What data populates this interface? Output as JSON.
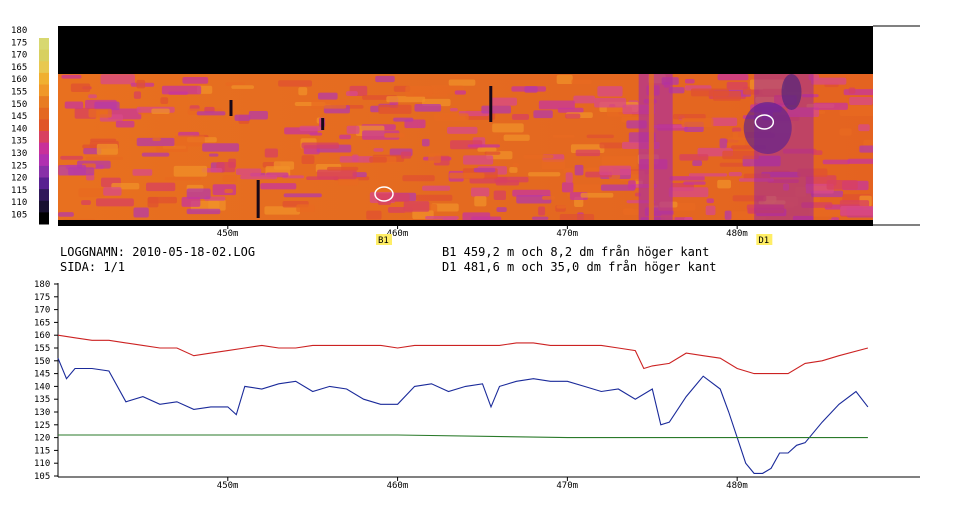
{
  "header": {
    "logname": "LOGGNAMN: 2010-05-18-02.LOG",
    "page": "SIDA: 1/1",
    "markers": [
      "B1 459,2 m och 8,2 dm från höger kant",
      "D1 481,6 m och 35,0 dm från höger kant"
    ]
  },
  "colors": {
    "red_series": "#cc2222",
    "blue_series": "#1a2a9a",
    "green_series": "#2a7a2a",
    "marker_badge": "#ffee66"
  },
  "chart_data": [
    {
      "type": "heatmap",
      "colorscale_ticks": [
        180,
        175,
        170,
        165,
        160,
        155,
        150,
        145,
        140,
        135,
        130,
        125,
        120,
        115,
        110,
        105
      ],
      "x_ticks": [
        "450m",
        "460m",
        "470m",
        "480m"
      ],
      "x_tick_values": [
        450,
        460,
        470,
        480
      ],
      "xlim": [
        440,
        488
      ],
      "markers": [
        {
          "label": "B1",
          "x": 459.2
        },
        {
          "label": "D1",
          "x": 481.6
        }
      ]
    },
    {
      "type": "line",
      "x_ticks": [
        "450m",
        "460m",
        "470m",
        "480m"
      ],
      "x_tick_values": [
        450,
        460,
        470,
        480
      ],
      "xlim": [
        440,
        488
      ],
      "y_ticks": [
        180,
        175,
        170,
        165,
        160,
        155,
        150,
        145,
        140,
        135,
        130,
        125,
        120,
        115,
        110,
        105
      ],
      "ylim": [
        105,
        180
      ],
      "grid": false,
      "series": [
        {
          "color": "red",
          "x": [
            440,
            441,
            442,
            443,
            444,
            445,
            446,
            447,
            448,
            449,
            450,
            451,
            452,
            453,
            454,
            455,
            456,
            457,
            458,
            459,
            460,
            461,
            462,
            463,
            464,
            465,
            466,
            467,
            468,
            469,
            470,
            471,
            472,
            473,
            474,
            474.5,
            475,
            476,
            477,
            478,
            479,
            480,
            481,
            482,
            483,
            484,
            485,
            486,
            487.7
          ],
          "y": [
            160,
            159,
            158,
            158,
            157,
            156,
            155,
            155,
            152,
            153,
            154,
            155,
            156,
            155,
            155,
            156,
            156,
            156,
            156,
            156,
            155,
            156,
            156,
            156,
            156,
            156,
            156,
            157,
            157,
            156,
            156,
            156,
            156,
            155,
            154,
            147,
            148,
            149,
            153,
            152,
            151,
            147,
            145,
            145,
            145,
            149,
            150,
            152,
            155
          ]
        },
        {
          "color": "blue",
          "x": [
            440,
            440.5,
            441,
            442,
            443,
            444,
            445,
            446,
            447,
            448,
            449,
            450,
            450.5,
            451,
            452,
            453,
            454,
            455,
            456,
            457,
            458,
            459,
            460,
            461,
            462,
            463,
            464,
            465,
            465.5,
            466,
            467,
            468,
            469,
            470,
            471,
            472,
            473,
            474,
            475,
            475.5,
            476,
            477,
            478,
            479,
            479.5,
            480,
            480.5,
            481,
            481.5,
            482,
            482.5,
            483,
            483.5,
            484,
            485,
            486,
            487,
            487.7
          ],
          "y": [
            151,
            143,
            147,
            147,
            146,
            134,
            136,
            133,
            134,
            131,
            132,
            132,
            129,
            140,
            139,
            141,
            142,
            138,
            140,
            139,
            135,
            133,
            133,
            140,
            141,
            138,
            140,
            141,
            132,
            140,
            142,
            143,
            142,
            142,
            140,
            138,
            139,
            135,
            139,
            125,
            126,
            136,
            144,
            139,
            130,
            120,
            110,
            106,
            106,
            108,
            114,
            114,
            117,
            118,
            126,
            133,
            138,
            132
          ]
        },
        {
          "color": "green",
          "x": [
            440,
            450,
            460,
            470,
            480,
            487.7
          ],
          "y": [
            121,
            121,
            121,
            120,
            120,
            120
          ]
        }
      ]
    }
  ]
}
